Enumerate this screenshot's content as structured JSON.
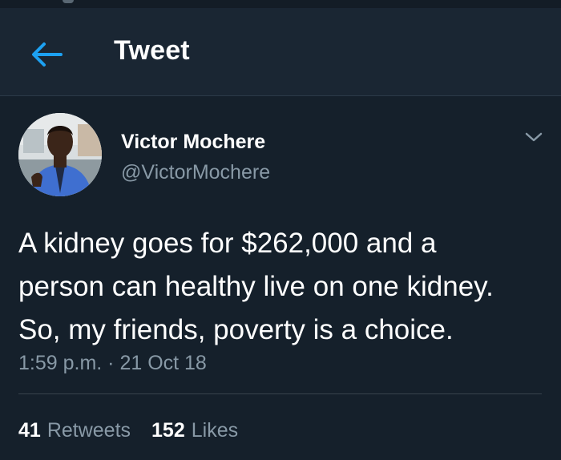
{
  "header": {
    "title": "Tweet",
    "back_icon": "arrow-left-icon"
  },
  "tweet": {
    "author": {
      "name": "Victor Mochere",
      "handle": "@VictorMochere"
    },
    "menu_icon": "chevron-down-icon",
    "text": "A kidney goes for $262,000 and a\nperson can healthy live on one kidney.\nSo, my friends, poverty is a choice.",
    "timestamp": "1:59 p.m. · 21 Oct 18",
    "stats": {
      "retweets_count": "41",
      "retweets_label": "Retweets",
      "likes_count": "152",
      "likes_label": "Likes"
    }
  },
  "colors": {
    "background": "#15202b",
    "header_background": "#1a2633",
    "accent": "#1da1f2",
    "secondary_text": "#8899a6"
  }
}
